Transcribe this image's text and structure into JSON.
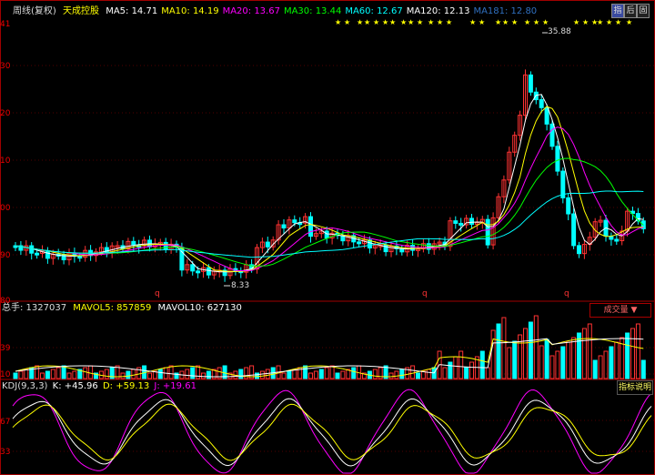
{
  "header": {
    "period": "周线(复权)",
    "stock_name": "天成控股",
    "ma_items": [
      {
        "label": "MA5: 14.71",
        "color": "#ffffff"
      },
      {
        "label": "MA10: 14.19",
        "color": "#ffff00"
      },
      {
        "label": "MA20: 13.67",
        "color": "#ff00ff"
      },
      {
        "label": "MA30: 13.44",
        "color": "#00ff00"
      },
      {
        "label": "MA60: 12.67",
        "color": "#00ffff"
      },
      {
        "label": "MA120: 12.13",
        "color": "#ffffff"
      },
      {
        "label": "MA181: 12.80",
        "color": "#3070c0"
      }
    ],
    "buttons": [
      "指",
      "后",
      "固"
    ]
  },
  "price_axis": {
    "ticks": [
      "41",
      "30",
      "20",
      "10",
      "00",
      "90",
      "80"
    ]
  },
  "annotations": {
    "high": "35.88",
    "low": "8.33",
    "markers": [
      "q",
      "q",
      "q"
    ],
    "stars": "★"
  },
  "volume": {
    "label": "总手: 1327037",
    "mavol5": "MAVOL5: 857859",
    "mavol10": "MAVOL10: 627130",
    "dropdown": "成交量",
    "ticks": [
      "39",
      "10"
    ]
  },
  "kdj": {
    "label": "KDJ(9,3,3)",
    "k": "K: +45.96",
    "d": "D: +59.13",
    "j": "J: +19.61",
    "help": "指标说明",
    "ticks": [
      "67",
      "33"
    ]
  },
  "colors": {
    "up": "#ff3333",
    "down": "#00ffff",
    "k": "#ffffff",
    "d": "#ffff00",
    "j": "#ff00ff"
  }
}
